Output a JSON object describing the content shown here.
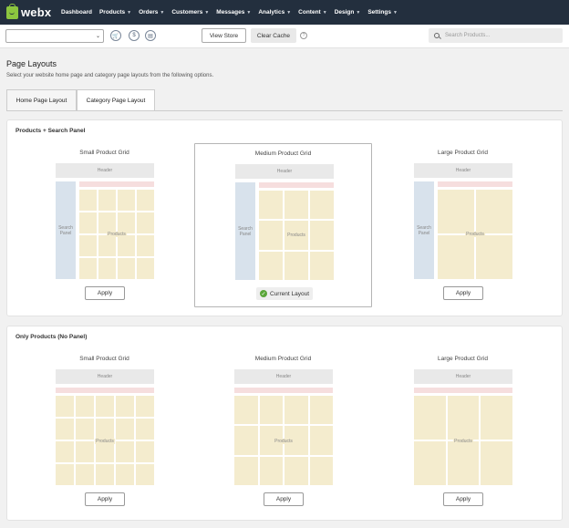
{
  "brand": {
    "name": "webx",
    "accent": "#8cc63f"
  },
  "nav": [
    {
      "label": "Dashboard",
      "dropdown": false
    },
    {
      "label": "Products",
      "dropdown": true
    },
    {
      "label": "Orders",
      "dropdown": true
    },
    {
      "label": "Customers",
      "dropdown": true
    },
    {
      "label": "Messages",
      "dropdown": true
    },
    {
      "label": "Analytics",
      "dropdown": true
    },
    {
      "label": "Content",
      "dropdown": true
    },
    {
      "label": "Design",
      "dropdown": true
    },
    {
      "label": "Settings",
      "dropdown": true
    }
  ],
  "toolbar": {
    "store_select_value": "",
    "view_store": "View Store",
    "clear_cache": "Clear Cache",
    "search_placeholder": "Search Products..."
  },
  "page": {
    "title": "Page Layouts",
    "subtitle": "Select your website home page and category page layouts from the following options."
  },
  "tabs": [
    {
      "label": "Home Page Layout",
      "active": false
    },
    {
      "label": "Category Page Layout",
      "active": true
    }
  ],
  "mock_labels": {
    "header": "Header",
    "search_panel": "Search Panel",
    "products": "Products"
  },
  "sections": [
    {
      "title": "Products + Search Panel",
      "layouts": [
        {
          "name": "Small Product Grid",
          "action": "Apply",
          "current": false
        },
        {
          "name": "Medium Product Grid",
          "action": "Current Layout",
          "current": true
        },
        {
          "name": "Large Product Grid",
          "action": "Apply",
          "current": false
        }
      ]
    },
    {
      "title": "Only Products (No Panel)",
      "layouts": [
        {
          "name": "Small Product Grid",
          "action": "Apply",
          "current": false
        },
        {
          "name": "Medium Product Grid",
          "action": "Apply",
          "current": false
        },
        {
          "name": "Large Product Grid",
          "action": "Apply",
          "current": false
        }
      ]
    }
  ]
}
